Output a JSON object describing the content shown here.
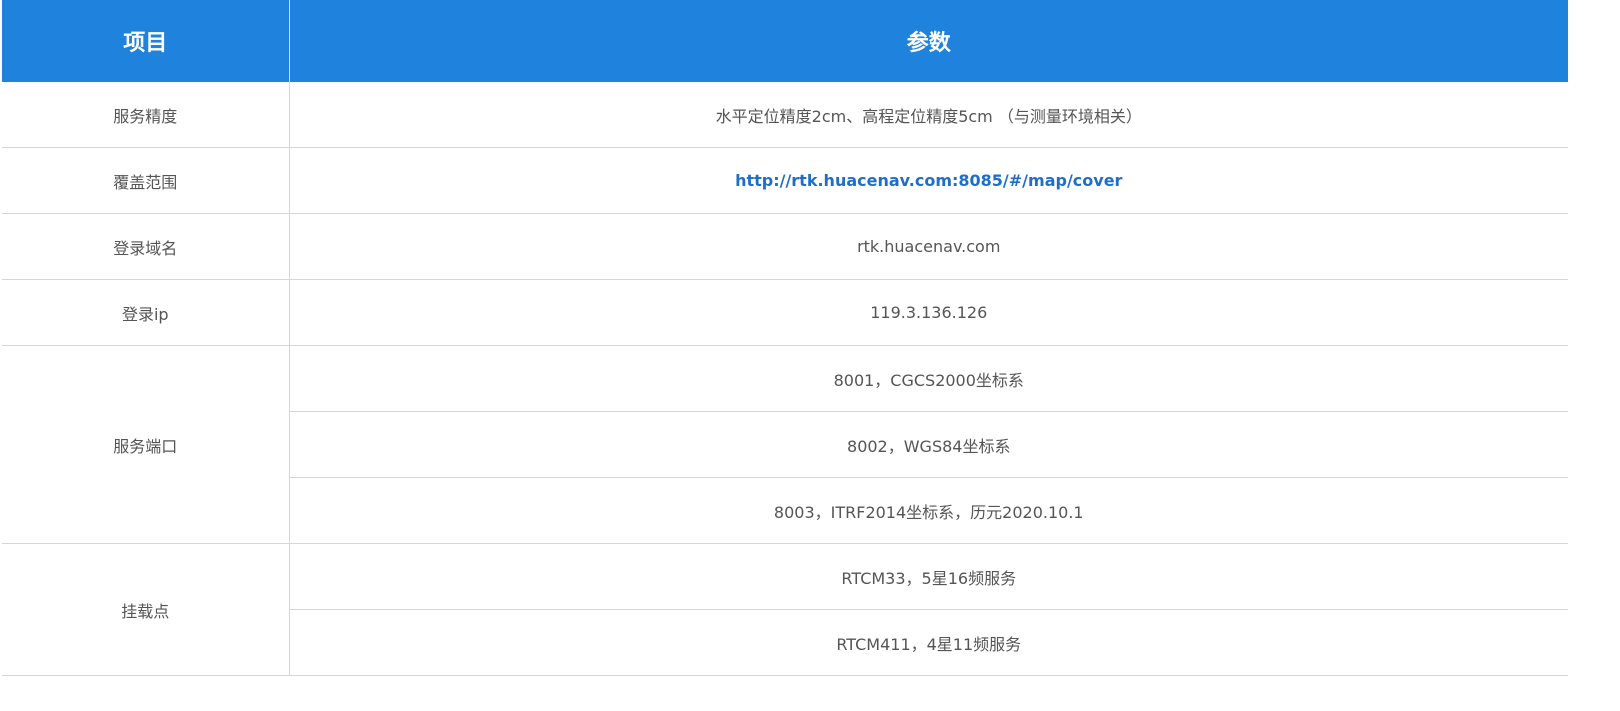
{
  "header": {
    "col1": "项目",
    "col2": "参数"
  },
  "rows": {
    "precision": {
      "label": "服务精度",
      "value": "水平定位精度2cm、高程定位精度5cm （与测量环境相关）"
    },
    "coverage": {
      "label": "覆盖范围",
      "value": "http://rtk.huacenav.com:8085/#/map/cover"
    },
    "domain": {
      "label": "登录域名",
      "value": "rtk.huacenav.com"
    },
    "ip": {
      "label": "登录ip",
      "value": "119.3.136.126"
    },
    "ports": {
      "label": "服务端口",
      "values": [
        "8001，CGCS2000坐标系",
        "8002，WGS84坐标系",
        "8003，ITRF2014坐标系，历元2020.10.1"
      ]
    },
    "mountpoints": {
      "label": "挂载点",
      "values": [
        "RTCM33，5星16频服务",
        "RTCM411，4星11频服务"
      ]
    }
  },
  "colors": {
    "header_bg": "#1f83de",
    "link": "#1f6fc9",
    "text": "#555555"
  }
}
